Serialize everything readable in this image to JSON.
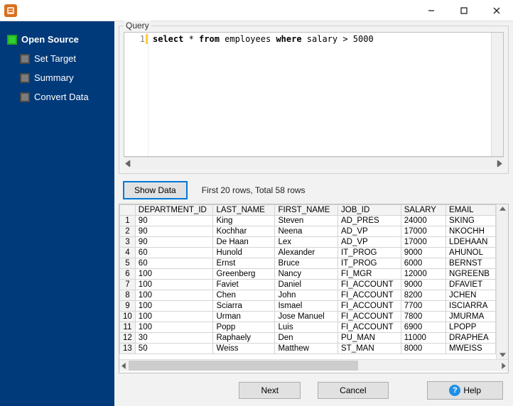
{
  "sidebar": {
    "items": [
      {
        "label": "Open Source",
        "active": true
      },
      {
        "label": "Set Target",
        "active": false
      },
      {
        "label": "Summary",
        "active": false
      },
      {
        "label": "Convert Data",
        "active": false
      }
    ]
  },
  "query": {
    "legend": "Query",
    "line_no": "1",
    "tokens": [
      "select",
      " * ",
      "from",
      " employees ",
      "where",
      " salary > 5000"
    ]
  },
  "buttons": {
    "show_data": "Show Data",
    "next": "Next",
    "cancel": "Cancel",
    "help": "Help"
  },
  "status": {
    "row_info": "First 20 rows, Total 58 rows"
  },
  "grid": {
    "columns": [
      "DEPARTMENT_ID",
      "LAST_NAME",
      "FIRST_NAME",
      "JOB_ID",
      "SALARY",
      "EMAIL"
    ],
    "rows": [
      {
        "n": "1",
        "cells": [
          "90",
          "King",
          "Steven",
          "AD_PRES",
          "24000",
          "SKING"
        ]
      },
      {
        "n": "2",
        "cells": [
          "90",
          "Kochhar",
          "Neena",
          "AD_VP",
          "17000",
          "NKOCHH"
        ]
      },
      {
        "n": "3",
        "cells": [
          "90",
          "De Haan",
          "Lex",
          "AD_VP",
          "17000",
          "LDEHAAN"
        ]
      },
      {
        "n": "4",
        "cells": [
          "60",
          "Hunold",
          "Alexander",
          "IT_PROG",
          "9000",
          "AHUNOL"
        ]
      },
      {
        "n": "5",
        "cells": [
          "60",
          "Ernst",
          "Bruce",
          "IT_PROG",
          "6000",
          "BERNST"
        ]
      },
      {
        "n": "6",
        "cells": [
          "100",
          "Greenberg",
          "Nancy",
          "FI_MGR",
          "12000",
          "NGREENB"
        ]
      },
      {
        "n": "7",
        "cells": [
          "100",
          "Faviet",
          "Daniel",
          "FI_ACCOUNT",
          "9000",
          "DFAVIET"
        ]
      },
      {
        "n": "8",
        "cells": [
          "100",
          "Chen",
          "John",
          "FI_ACCOUNT",
          "8200",
          "JCHEN"
        ]
      },
      {
        "n": "9",
        "cells": [
          "100",
          "Sciarra",
          "Ismael",
          "FI_ACCOUNT",
          "7700",
          "ISCIARRA"
        ]
      },
      {
        "n": "10",
        "cells": [
          "100",
          "Urman",
          "Jose Manuel",
          "FI_ACCOUNT",
          "7800",
          "JMURMA"
        ]
      },
      {
        "n": "11",
        "cells": [
          "100",
          "Popp",
          "Luis",
          "FI_ACCOUNT",
          "6900",
          "LPOPP"
        ]
      },
      {
        "n": "12",
        "cells": [
          "30",
          "Raphaely",
          "Den",
          "PU_MAN",
          "11000",
          "DRAPHEA"
        ]
      },
      {
        "n": "13",
        "cells": [
          "50",
          "Weiss",
          "Matthew",
          "ST_MAN",
          "8000",
          "MWEISS"
        ]
      }
    ]
  }
}
